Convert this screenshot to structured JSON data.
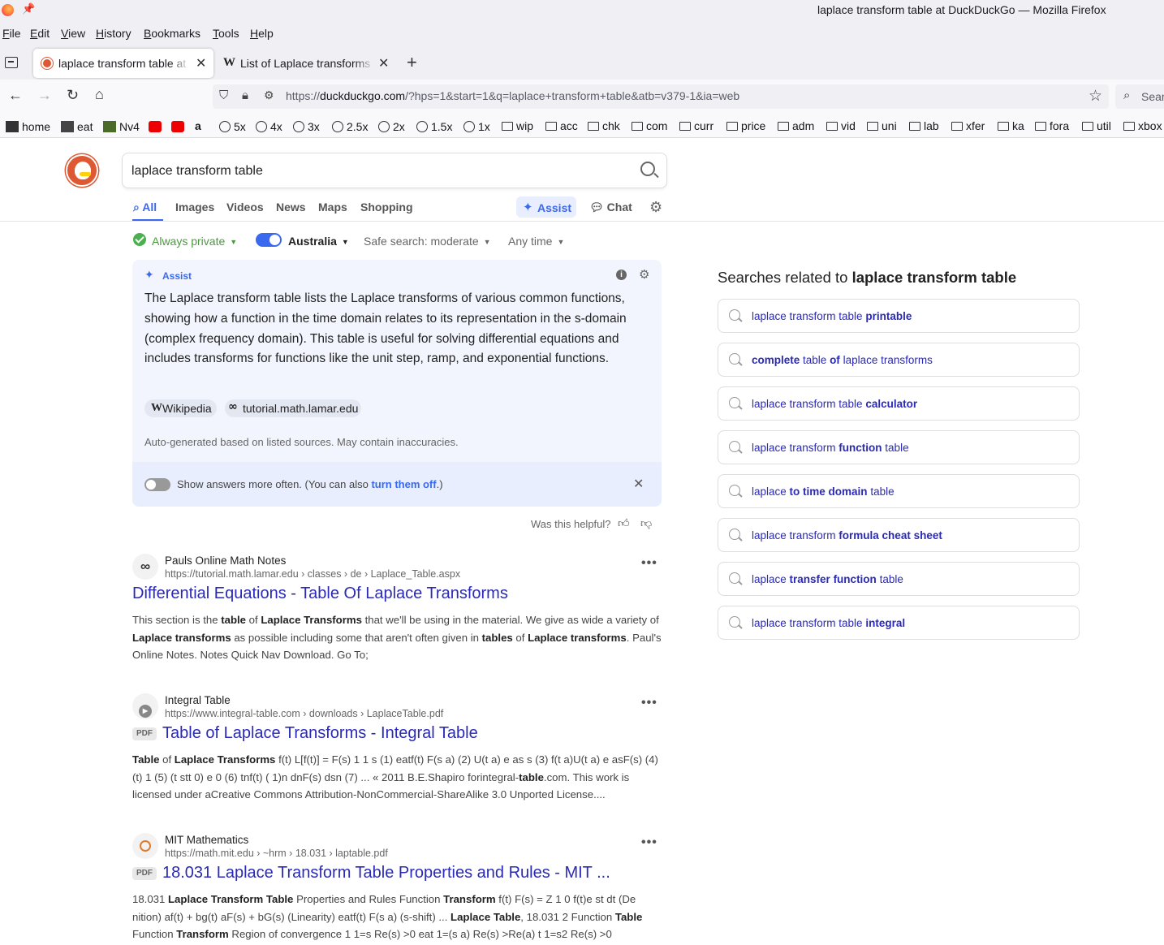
{
  "window": {
    "title": "laplace transform table at DuckDuckGo — Mozilla Firefox"
  },
  "menu": [
    "File",
    "Edit",
    "View",
    "History",
    "Bookmarks",
    "Tools",
    "Help"
  ],
  "tabs": [
    {
      "label": "laplace transform table at DuckDuckGo",
      "icon": "duckduckgo-favicon",
      "active": true
    },
    {
      "label": "List of Laplace transforms",
      "icon": "wikipedia-favicon",
      "active": false
    }
  ],
  "urlbar": {
    "scheme": "https://",
    "host": "duckduckgo.com",
    "path": "/?hps=1&start=1&q=laplace+transform+table&atb=v379-1&ia=web",
    "search_placeholder": "Sear"
  },
  "bookmarks": [
    "home",
    "eat",
    "Nv4",
    "",
    "",
    "",
    "5x",
    "4x",
    "3x",
    "2.5x",
    "2x",
    "1.5x",
    "1x",
    "wip",
    "acc",
    "chk",
    "com",
    "curr",
    "price",
    "adm",
    "vid",
    "uni",
    "lab",
    "xfer",
    "ka",
    "fora",
    "util",
    "xbox"
  ],
  "search": {
    "query": "laplace transform table"
  },
  "verticals": [
    "All",
    "Images",
    "Videos",
    "News",
    "Maps",
    "Shopping"
  ],
  "assist_label": "Assist",
  "chat_label": "Chat",
  "filters": {
    "privacy": "Always private",
    "region": "Australia",
    "safe_search": "Safe search: moderate",
    "time": "Any time"
  },
  "assist": {
    "label": "Assist",
    "answer": "The Laplace transform table lists the Laplace transforms of various common functions, showing how a function in the time domain relates to its representation in the s-domain (complex frequency domain). This table is useful for solving differential equations and includes transforms for functions like the unit step, ramp, and exponential functions.",
    "sources": [
      "Wikipedia",
      "tutorial.math.lamar.edu"
    ],
    "disclaimer": "Auto-generated based on listed sources. May contain inaccuracies.",
    "footer_text": "Show answers more often. (You can also ",
    "footer_link": "turn them off",
    "footer_end": ".)",
    "helpful": "Was this helpful?"
  },
  "results": [
    {
      "site": "Pauls Online Math Notes",
      "url": "https://tutorial.math.lamar.edu › classes › de › Laplace_Table.aspx",
      "title": "Differential Equations - Table Of Laplace Transforms",
      "pdf": false,
      "snippet": [
        [
          "This section is the ",
          false
        ],
        [
          "table",
          true
        ],
        [
          " of ",
          false
        ],
        [
          "Laplace Transforms",
          true
        ],
        [
          " that we'll be using in the material. We give as wide a variety of ",
          false
        ],
        [
          "Laplace transforms",
          true
        ],
        [
          " as possible including some that aren't often given in ",
          false
        ],
        [
          "tables",
          true
        ],
        [
          " of ",
          false
        ],
        [
          "Laplace transforms",
          true
        ],
        [
          ". Paul's Online Notes. Notes Quick Nav Download. Go To;",
          false
        ]
      ]
    },
    {
      "site": "Integral Table",
      "url": "https://www.integral-table.com › downloads › LaplaceTable.pdf",
      "title": "Table of Laplace Transforms - Integral Table",
      "pdf": true,
      "pdf_label": "PDF",
      "snippet": [
        [
          "Table",
          true
        ],
        [
          " of ",
          false
        ],
        [
          "Laplace Transforms",
          true
        ],
        [
          " f(t) L[f(t)] = F(s) 1 1 s (1) eatf(t) F(s a) (2) U(t a) e as s (3) f(t a)U(t a) e asF(s) (4) (t) 1 (5) (t stt 0) e 0 (6) tnf(t) ( 1)n dnF(s) dsn (7) ... « 2011 B.E.Shapiro forintegral-",
          false
        ],
        [
          "table",
          true
        ],
        [
          ".com. This work is licensed under aCreative Commons Attribution-NonCommercial-ShareAlike 3.0 Unported License....",
          false
        ]
      ]
    },
    {
      "site": "MIT Mathematics",
      "url": "https://math.mit.edu › ~hrm › 18.031 › laptable.pdf",
      "title": "18.031 Laplace Transform Table Properties and Rules - MIT ...",
      "pdf": true,
      "pdf_label": "PDF",
      "snippet": [
        [
          "18.031 ",
          false
        ],
        [
          "Laplace Transform Table",
          true
        ],
        [
          " Properties and Rules Function ",
          false
        ],
        [
          "Transform",
          true
        ],
        [
          " f(t) F(s) = Z 1 0 f(t)e st dt (De nition) af(t) + bg(t) aF(s) + bG(s) (Linearity) eatf(t) F(s a) (s-shift) ... ",
          false
        ],
        [
          "Laplace Table",
          true
        ],
        [
          ", 18.031 2 Function ",
          false
        ],
        [
          "Table",
          true
        ],
        [
          " Function ",
          false
        ],
        [
          "Transform",
          true
        ],
        [
          " Region of convergence 1 1=s Re(s) >0 eat 1=(s a) Re(s) >Re(a) t 1=s2 Re(s) >0",
          false
        ]
      ]
    }
  ],
  "related": {
    "heading_prefix": "Searches related to ",
    "heading_query": "laplace transform table",
    "items": [
      [
        [
          "laplace transform table ",
          false
        ],
        [
          "printable",
          true
        ]
      ],
      [
        [
          "complete",
          true
        ],
        [
          " table ",
          false
        ],
        [
          "of",
          true
        ],
        [
          " laplace transforms",
          false
        ]
      ],
      [
        [
          "laplace transform table ",
          false
        ],
        [
          "calculator",
          true
        ]
      ],
      [
        [
          "laplace transform ",
          false
        ],
        [
          "function",
          true
        ],
        [
          " table",
          false
        ]
      ],
      [
        [
          "laplace ",
          false
        ],
        [
          "to time domain",
          true
        ],
        [
          " table",
          false
        ]
      ],
      [
        [
          "laplace transform ",
          false
        ],
        [
          "formula cheat sheet",
          true
        ]
      ],
      [
        [
          "laplace ",
          false
        ],
        [
          "transfer function",
          true
        ],
        [
          " table",
          false
        ]
      ],
      [
        [
          "laplace transform table ",
          false
        ],
        [
          "integral",
          true
        ]
      ]
    ]
  },
  "colors": {
    "accent": "#3969ef",
    "link": "#2a29b8",
    "ddg_orange": "#de5833"
  }
}
